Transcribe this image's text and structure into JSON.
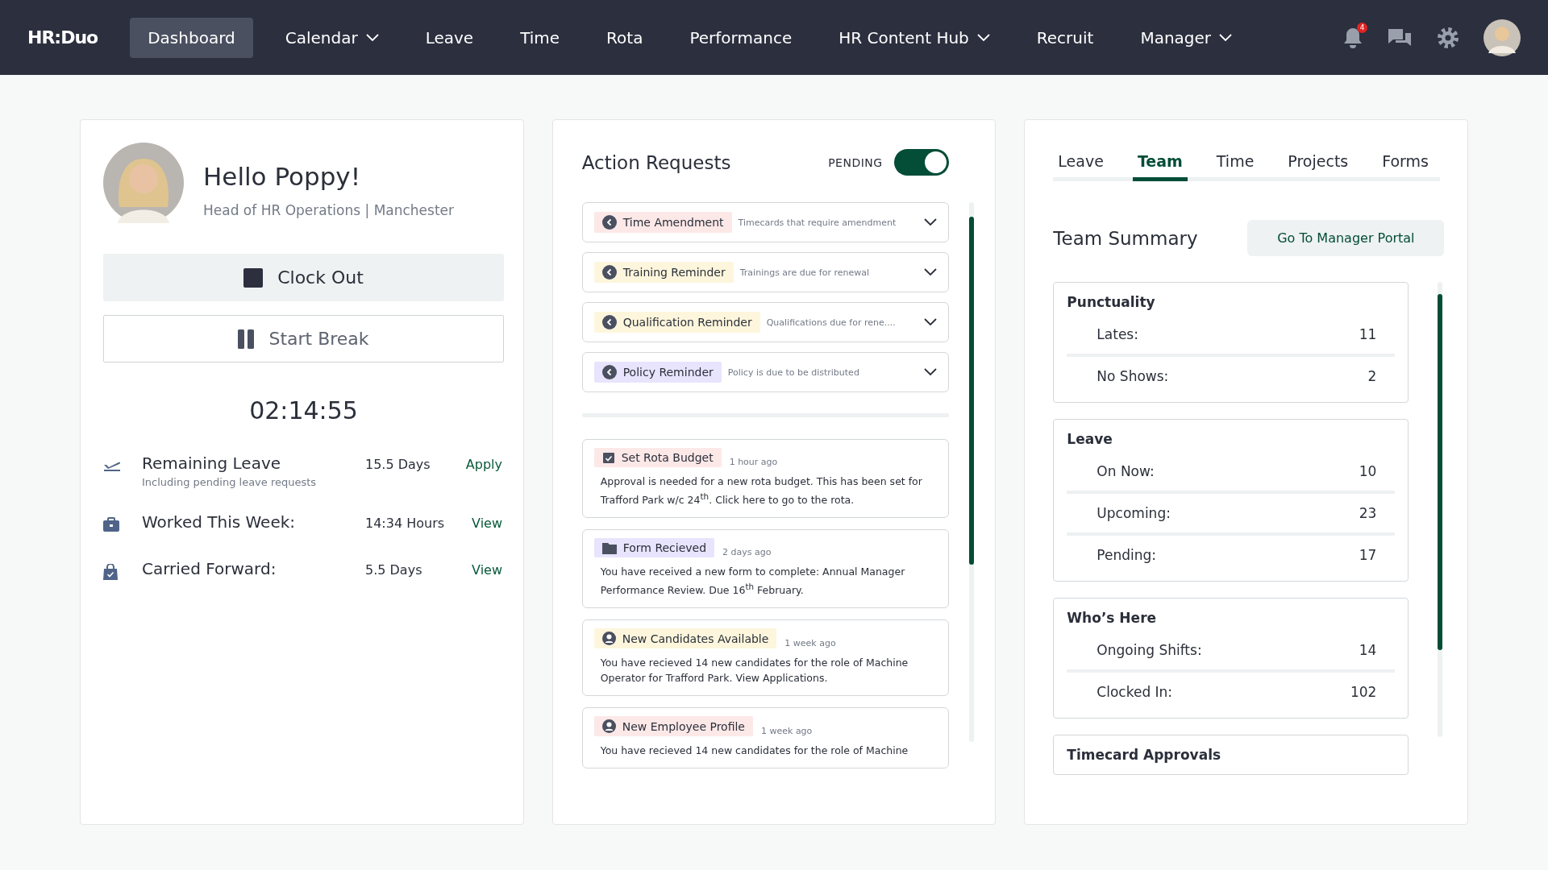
{
  "nav": {
    "logo": "HR:Duo",
    "items": [
      {
        "label": "Dashboard",
        "selected": true,
        "dropdown": false
      },
      {
        "label": "Calendar",
        "selected": false,
        "dropdown": true
      },
      {
        "label": "Leave",
        "selected": false,
        "dropdown": false
      },
      {
        "label": "Time",
        "selected": false,
        "dropdown": false
      },
      {
        "label": "Rota",
        "selected": false,
        "dropdown": false
      },
      {
        "label": "Performance",
        "selected": false,
        "dropdown": false
      },
      {
        "label": "HR Content Hub",
        "selected": false,
        "dropdown": true
      },
      {
        "label": "Recruit",
        "selected": false,
        "dropdown": false
      },
      {
        "label": "Manager",
        "selected": false,
        "dropdown": true
      }
    ],
    "notification_count": "4"
  },
  "profile": {
    "greeting": "Hello Poppy!",
    "subtitle": "Head of HR Operations | Manchester",
    "clock_out": "Clock Out",
    "start_break": "Start Break",
    "timer": "02:14:55",
    "stats": [
      {
        "kind": "plane",
        "label": "Remaining Leave",
        "note": "Including pending leave requests",
        "value": "15.5 Days",
        "action": "Apply"
      },
      {
        "kind": "briefcase",
        "label": "Worked This Week:",
        "value": "14:34 Hours",
        "action": "View"
      },
      {
        "kind": "bag",
        "label": "Carried Forward:",
        "value": "5.5 Days",
        "action": "View"
      }
    ]
  },
  "action_requests": {
    "title": "Action Requests",
    "toggle_label": "PENDING",
    "toggle_on": true,
    "requests": [
      {
        "tag": "Time Amendment",
        "color": "#fde8e8",
        "description": "Timecards that require amendment"
      },
      {
        "tag": "Training Reminder",
        "color": "#fdf6dc",
        "description": "Trainings are due for renewal"
      },
      {
        "tag": "Qualification Reminder",
        "color": "#fdf6dc",
        "description": "Qualifications due for rene...."
      },
      {
        "tag": "Policy Reminder",
        "color": "#e8e4fd",
        "description": "Policy is due to be distributed"
      }
    ],
    "notifications": [
      {
        "kind": "calendar",
        "tag": "Set Rota Budget",
        "color": "#fde8e8",
        "time": "1 hour ago",
        "text": "Approval is needed for a new rota budget. This has been set for Trafford Park w/c 24$^{th}$. Click here to go to the rota."
      },
      {
        "kind": "folder",
        "tag": "Form Recieved",
        "color": "#e8e4fd",
        "time": "2 days ago",
        "text": "You have received a new form to complete: Annual Manager Performance Review. Due 16$^{th}$ February."
      },
      {
        "kind": "person",
        "tag": "New Candidates Available",
        "color": "#fdf6dc",
        "time": "1 week ago",
        "text": "You have recieved 14 new candidates for the role of Machine Operator for Trafford Park. View Applications."
      },
      {
        "kind": "person",
        "tag": "New Employee Profile",
        "color": "#fde8e8",
        "time": "1 week ago",
        "text": "You have recieved 14 new candidates for the role of Machine"
      }
    ]
  },
  "team": {
    "tabs": [
      {
        "label": "Leave",
        "selected": false
      },
      {
        "label": "Team",
        "selected": true
      },
      {
        "label": "Time",
        "selected": false
      },
      {
        "label": "Projects",
        "selected": false
      },
      {
        "label": "Forms",
        "selected": false
      }
    ],
    "title": "Team Summary",
    "portal_button": "Go To Manager Portal",
    "groups": [
      {
        "title": "Punctuality",
        "rows": [
          {
            "label": "Lates:",
            "value": "11"
          },
          {
            "label": "No Shows:",
            "value": "2"
          }
        ]
      },
      {
        "title": "Leave",
        "rows": [
          {
            "label": "On Now:",
            "value": "10"
          },
          {
            "label": "Upcoming:",
            "value": "23"
          },
          {
            "label": "Pending:",
            "value": "17"
          }
        ]
      },
      {
        "title": "Who’s Here",
        "rows": [
          {
            "label": "Ongoing Shifts:",
            "value": "14"
          },
          {
            "label": "Clocked In:",
            "value": "102"
          }
        ]
      },
      {
        "title": "Timecard Approvals"
      }
    ]
  }
}
